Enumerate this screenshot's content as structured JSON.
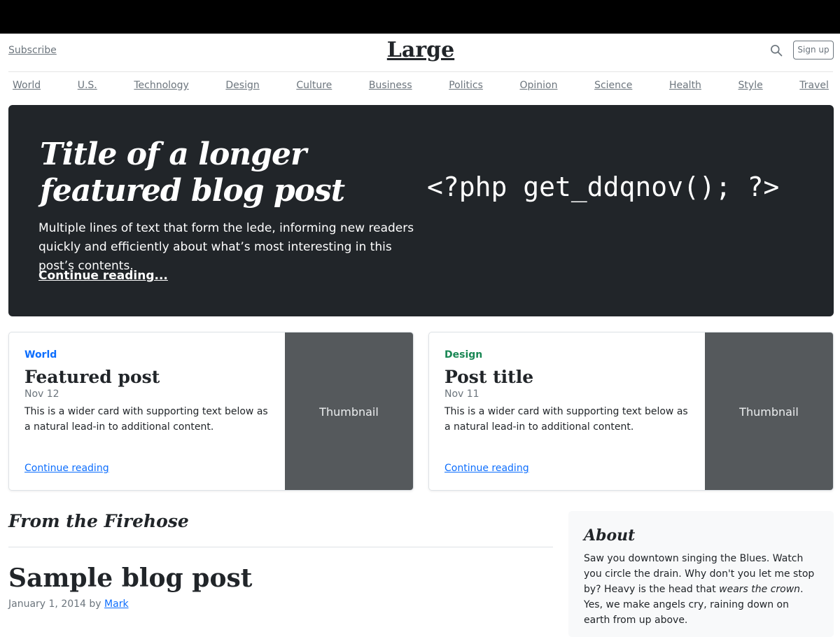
{
  "header": {
    "subscribe_label": "Subscribe",
    "logo": "Large",
    "signup_label": "Sign up"
  },
  "nav": [
    "World",
    "U.S.",
    "Technology",
    "Design",
    "Culture",
    "Business",
    "Politics",
    "Opinion",
    "Science",
    "Health",
    "Style",
    "Travel"
  ],
  "hero": {
    "title": "Title of a longer featured blog post",
    "lede": "Multiple lines of text that form the lede, informing new readers quickly and efficiently about what’s most interesting in this post’s contents.",
    "link": "Continue reading...",
    "code": "<?php get_ddqnov(); ?>"
  },
  "cards": [
    {
      "category": "World",
      "category_color": "#0d6efd",
      "title": "Featured post",
      "date": "Nov 12",
      "text": "This is a wider card with supporting text below as a natural lead-in to additional content.",
      "link": "Continue reading",
      "thumbnail": "Thumbnail"
    },
    {
      "category": "Design",
      "category_color": "#198754",
      "title": "Post title",
      "date": "Nov 11",
      "text": "This is a wider card with supporting text below as a natural lead-in to additional content.",
      "link": "Continue reading",
      "thumbnail": "Thumbnail"
    }
  ],
  "firehose": {
    "heading": "From the Firehose",
    "post_title": "Sample blog post",
    "post_date": "January 1, 2014 by",
    "post_author": "Mark"
  },
  "about": {
    "title": "About",
    "text_before": "Saw you downtown singing the Blues. Watch you circle the drain. Why don't you let me stop by? Heavy is the head that ",
    "text_italic": "wears the crown",
    "text_after": ". Yes, we make angels cry, raining down on earth from up above."
  }
}
